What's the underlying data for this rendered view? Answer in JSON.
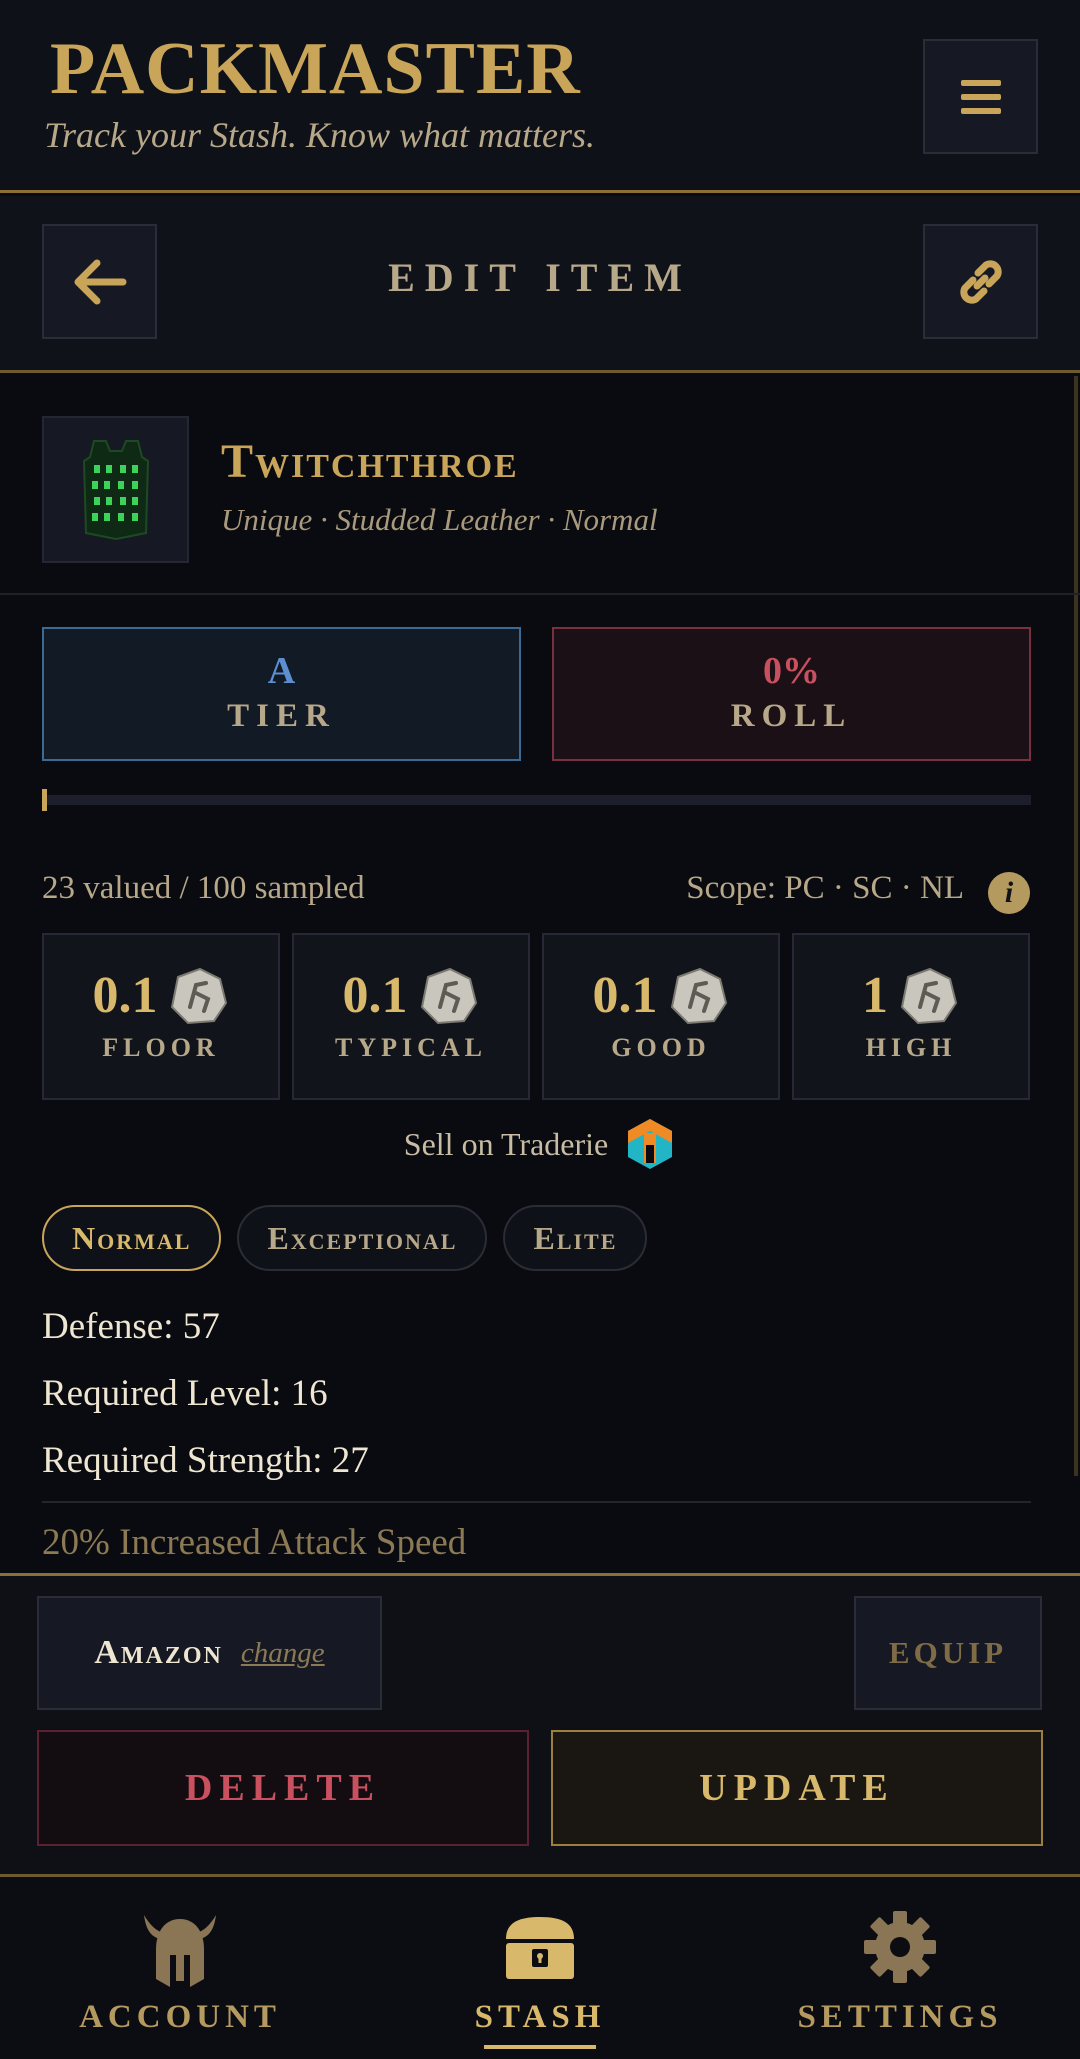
{
  "header": {
    "title": "PACKMASTER",
    "tagline": "Track your Stash. Know what matters.",
    "menu_icon": "hamburger-menu-icon"
  },
  "subheader": {
    "title": "EDIT ITEM",
    "back_icon": "arrow-left-icon",
    "link_icon": "chain-link-icon"
  },
  "item": {
    "name": "Twitchthroe",
    "subtitle": "Unique · Studded Leather · Normal",
    "image_icon": "green-armor-icon"
  },
  "tier": {
    "value": "A",
    "label": "TIER",
    "color": "#5b8fd0"
  },
  "roll": {
    "value": "0%",
    "label": "ROLL",
    "color": "#c9505f",
    "fraction": 0.0
  },
  "valuation": {
    "sample_text": "23 valued / 100 sampled",
    "scope_text": "Scope: PC · SC · NL",
    "info_icon": "info-icon"
  },
  "prices": [
    {
      "value": "0.1",
      "label": "FLOOR",
      "icon": "rune-icon"
    },
    {
      "value": "0.1",
      "label": "TYPICAL",
      "icon": "rune-icon"
    },
    {
      "value": "0.1",
      "label": "GOOD",
      "icon": "rune-icon"
    },
    {
      "value": "1",
      "label": "HIGH",
      "icon": "rune-icon"
    }
  ],
  "sell": {
    "label": "Sell on Traderie",
    "icon": "traderie-logo-icon"
  },
  "tabs": [
    {
      "label": "Normal",
      "active": true
    },
    {
      "label": "Exceptional",
      "active": false
    },
    {
      "label": "Elite",
      "active": false
    }
  ],
  "properties": [
    "Defense: 57",
    "Required Level: 16",
    "Required Strength: 27"
  ],
  "mods": [
    "20% Increased Attack Speed"
  ],
  "actions": {
    "class_name": "Amazon",
    "change_label": "change",
    "equip_label": "EQUIP",
    "delete_label": "DELETE",
    "update_label": "UPDATE"
  },
  "nav": [
    {
      "label": "ACCOUNT",
      "icon": "helmet-icon",
      "active": false
    },
    {
      "label": "STASH",
      "icon": "chest-icon",
      "active": true
    },
    {
      "label": "SETTINGS",
      "icon": "gear-icon",
      "active": false
    }
  ],
  "colors": {
    "accent_gold": "#c9a559",
    "background": "#0a0b10",
    "tier_blue": "#5b8fd0",
    "roll_red": "#c9505f"
  }
}
